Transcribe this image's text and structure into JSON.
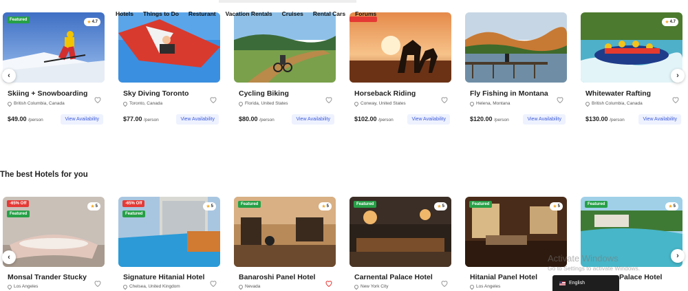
{
  "nav": [
    "Hotels",
    "Things to Do",
    "Resturant",
    "Vacation Rentals",
    "Cruises",
    "Rental Cars",
    "Forums"
  ],
  "activities": [
    {
      "title": "Skiing + Snowboarding",
      "location": "British Columbia, Canada",
      "price": "$49.00",
      "per": "/person",
      "rating": "4.7",
      "badge": "Featured",
      "cta": "View Availability"
    },
    {
      "title": "Sky Diving Toronto",
      "location": "Toronto, Canada",
      "price": "$77.00",
      "per": "/person",
      "rating": "",
      "badge": "",
      "cta": "View Availability"
    },
    {
      "title": "Cycling Biking",
      "location": "Florida, United States",
      "price": "$80.00",
      "per": "/person",
      "rating": "",
      "badge": "",
      "cta": "View Availability"
    },
    {
      "title": "Horseback Riding",
      "location": "Conway, United States",
      "price": "$102.00",
      "per": "/person",
      "rating": "",
      "badge": "",
      "cta": "View Availability"
    },
    {
      "title": "Fly Fishing in Montana",
      "location": "Helena, Montana",
      "price": "$120.00",
      "per": "/person",
      "rating": "",
      "badge": "",
      "cta": "View Availability"
    },
    {
      "title": "Whitewater Rafting",
      "location": "British Columbia, Canada",
      "price": "$130.00",
      "per": "/person",
      "rating": "4.7",
      "badge": "",
      "cta": "View Availability"
    }
  ],
  "hotels_section_title": "The best Hotels for you",
  "hotels": [
    {
      "title": "Monsal Trander Stucky",
      "location": "Los Angeles",
      "rating": "5",
      "discount": "-65% Off",
      "badge": "Featured",
      "favorited": false
    },
    {
      "title": "Signature Hitanial Hotel",
      "location": "Chelsea, United Kingdom",
      "rating": "5",
      "discount": "-65% Off",
      "badge": "Featured",
      "favorited": false
    },
    {
      "title": "Banaroshi Panel Hotel",
      "location": "Nevada",
      "rating": "5",
      "discount": "",
      "badge": "Featured",
      "favorited": true
    },
    {
      "title": "Carnental Palace Hotel",
      "location": "New York City",
      "rating": "5",
      "discount": "",
      "badge": "Featured",
      "favorited": false
    },
    {
      "title": "Hitanial Panel Hotel",
      "location": "Los Angeles",
      "rating": "5",
      "discount": "",
      "badge": "Featured",
      "favorited": false
    },
    {
      "title": "Palace Hotel",
      "location": "",
      "rating": "5",
      "discount": "",
      "badge": "Featured",
      "favorited": false
    }
  ],
  "watermark": {
    "line1": "Activate Windows",
    "line2": "Go to Settings to activate Windows."
  },
  "language": "English",
  "colors": {
    "featured": "#26a047",
    "discount": "#e53935",
    "link": "#3d5bd9",
    "heart_active": "#e53935"
  }
}
